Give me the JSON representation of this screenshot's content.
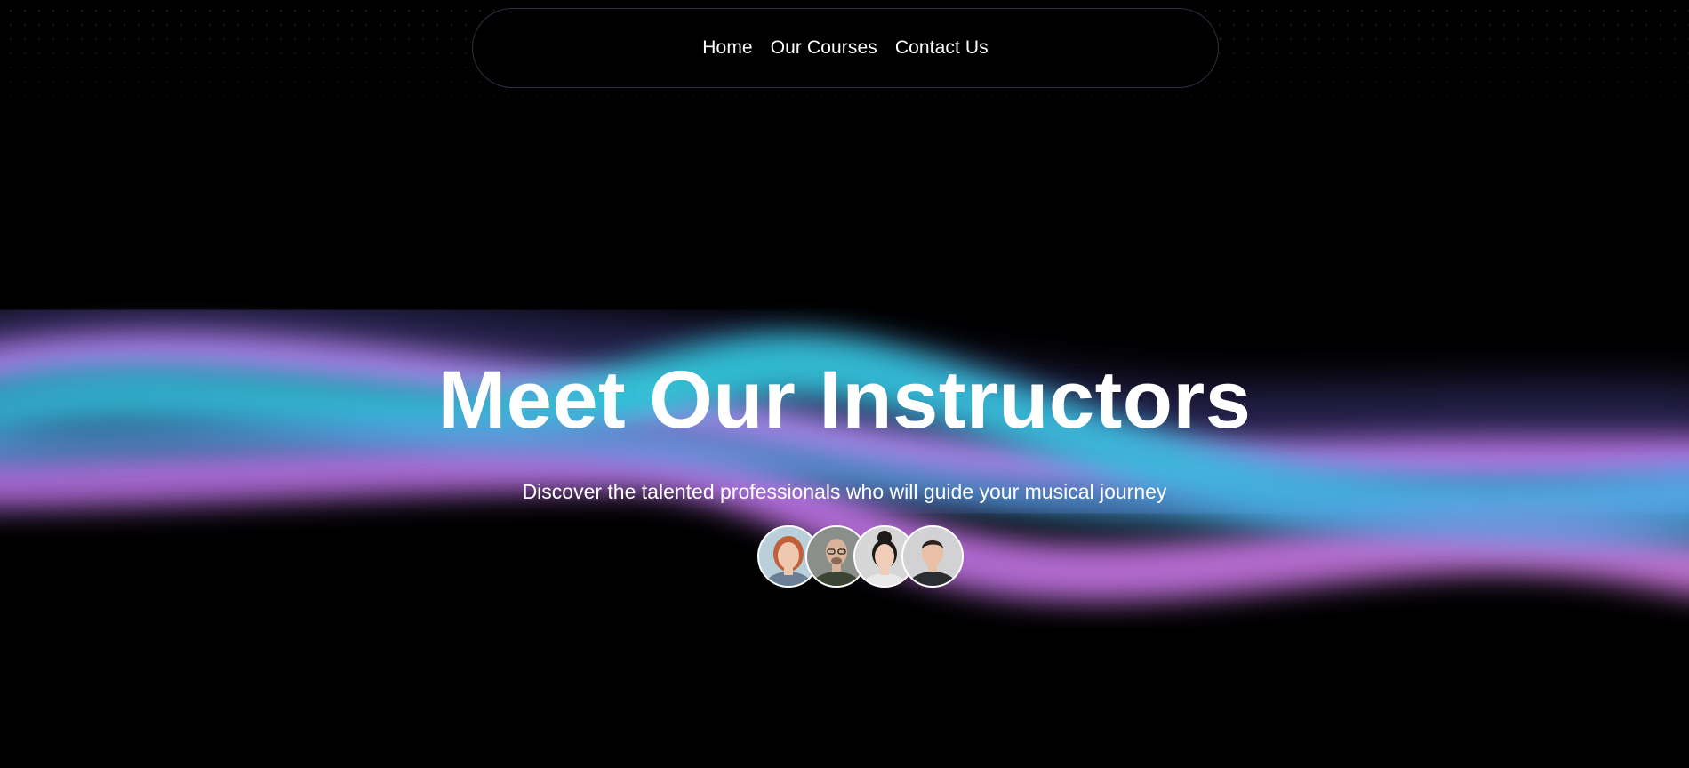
{
  "nav": {
    "items": [
      {
        "label": "Home"
      },
      {
        "label": "Our Courses"
      },
      {
        "label": "Contact Us"
      }
    ]
  },
  "hero": {
    "title": "Meet Our Instructors",
    "subtitle": "Discover the talented professionals who will guide your musical journey"
  },
  "avatars": [
    {
      "name": "instructor-avatar-red-hair-woman",
      "bg": "#b9cfd9",
      "skin": "#efc9ae",
      "hair": "#c0603a",
      "shirt": "#6a7f95"
    },
    {
      "name": "instructor-avatar-bald-man-glasses",
      "bg": "#8a8f8a",
      "skin": "#d9b39a",
      "hair": "#d9b39a",
      "shirt": "#3a4633"
    },
    {
      "name": "instructor-avatar-woman-bun",
      "bg": "#d6d6d6",
      "skin": "#f0cdb8",
      "hair": "#1e1a18",
      "shirt": "#e8e8e8"
    },
    {
      "name": "instructor-avatar-man-dark-shirt",
      "bg": "#d2d2d4",
      "skin": "#e7c0a6",
      "hair": "#2a2220",
      "shirt": "#2b2d33"
    }
  ],
  "theme": {
    "background": "#000000",
    "text": "#ffffff",
    "wave_cyan": "#2ec4d6",
    "wave_blue": "#4aa8e6",
    "wave_purple": "#b47ae8",
    "wave_pink": "#c874e6",
    "nav_border": "#2a3040"
  }
}
